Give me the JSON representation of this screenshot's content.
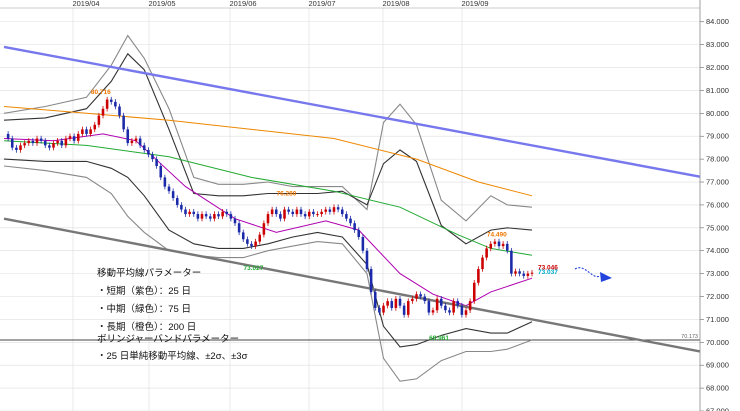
{
  "chart_data": {
    "type": "candlestick",
    "x_months": [
      "2019/04",
      "2019/05",
      "2019/06",
      "2019/07",
      "2019/08",
      "2019/09"
    ],
    "y_ticks": [
      "84.000",
      "83.000",
      "82.000",
      "81.000",
      "80.000",
      "79.000",
      "78.000",
      "77.000",
      "76.000",
      "75.000",
      "74.000",
      "73.000",
      "72.000",
      "71.000",
      "70.000",
      "69.000",
      "68.000",
      "67.000"
    ],
    "ylim": [
      67,
      84.6
    ],
    "grid": true,
    "closes": [
      79.1,
      78.9,
      78.5,
      78.4,
      78.6,
      78.7,
      78.8,
      78.7,
      78.9,
      78.8,
      78.6,
      78.5,
      78.7,
      78.8,
      78.6,
      78.9,
      79.0,
      78.8,
      79.1,
      79.3,
      79.1,
      79.3,
      79.5,
      79.9,
      80.2,
      80.6,
      80.5,
      80.3,
      79.9,
      79.3,
      78.7,
      78.8,
      78.9,
      78.6,
      78.4,
      78.2,
      78.0,
      77.7,
      77.2,
      76.8,
      76.6,
      76.3,
      76.0,
      75.8,
      75.6,
      75.7,
      75.6,
      75.4,
      75.6,
      75.5,
      75.4,
      75.6,
      75.5,
      75.7,
      75.6,
      75.4,
      75.2,
      74.8,
      74.5,
      74.3,
      74.2,
      74.4,
      74.7,
      75.2,
      75.6,
      75.8,
      75.6,
      75.4,
      75.8,
      75.7,
      75.6,
      75.8,
      75.6,
      75.5,
      75.7,
      75.6,
      75.6,
      75.7,
      75.8,
      75.7,
      75.9,
      75.8,
      75.6,
      75.4,
      75.2,
      74.9,
      74.6,
      74.0,
      73.2,
      72.2,
      71.5,
      71.3,
      71.6,
      71.8,
      71.5,
      71.9,
      71.6,
      71.2,
      71.8,
      71.9,
      72.1,
      72.0,
      71.8,
      71.3,
      71.4,
      71.9,
      71.6,
      71.4,
      71.3,
      71.8,
      71.6,
      71.2,
      71.4,
      71.8,
      72.6,
      73.2,
      73.7,
      74.1,
      74.3,
      74.4,
      74.2,
      74.3,
      74.0,
      73.0,
      73.1,
      73.0,
      72.9,
      73.0,
      73.04
    ],
    "moving_averages": [
      {
        "name": "short-25",
        "color": "#b000b0",
        "points": [
          [
            0,
            78.9
          ],
          [
            12,
            78.8
          ],
          [
            24,
            79.1
          ],
          [
            32,
            78.8
          ],
          [
            44,
            76.8
          ],
          [
            56,
            75.4
          ],
          [
            66,
            74.8
          ],
          [
            78,
            75.3
          ],
          [
            86,
            74.9
          ],
          [
            96,
            73.0
          ],
          [
            104,
            72.1
          ],
          [
            112,
            71.6
          ],
          [
            118,
            72.2
          ],
          [
            128,
            72.8
          ]
        ]
      },
      {
        "name": "medium-75",
        "color": "#22aa33",
        "points": [
          [
            0,
            78.8
          ],
          [
            20,
            78.6
          ],
          [
            40,
            78.1
          ],
          [
            60,
            77.2
          ],
          [
            80,
            76.6
          ],
          [
            96,
            75.9
          ],
          [
            110,
            74.7
          ],
          [
            118,
            74.1
          ],
          [
            128,
            73.8
          ]
        ]
      },
      {
        "name": "long-200",
        "color": "#ee8800",
        "points": [
          [
            0,
            80.3
          ],
          [
            20,
            80.0
          ],
          [
            40,
            79.7
          ],
          [
            60,
            79.3
          ],
          [
            80,
            78.9
          ],
          [
            100,
            78.0
          ],
          [
            115,
            77.0
          ],
          [
            128,
            76.4
          ]
        ]
      }
    ],
    "bollinger": [
      {
        "name": "+3σ",
        "color": "#888888",
        "points": [
          [
            0,
            80.0
          ],
          [
            10,
            80.3
          ],
          [
            20,
            80.7
          ],
          [
            26,
            82.1
          ],
          [
            30,
            83.4
          ],
          [
            34,
            82.4
          ],
          [
            40,
            80.2
          ],
          [
            46,
            77.2
          ],
          [
            52,
            76.9
          ],
          [
            58,
            76.9
          ],
          [
            64,
            77.0
          ],
          [
            70,
            76.8
          ],
          [
            76,
            76.8
          ],
          [
            82,
            76.8
          ],
          [
            88,
            75.8
          ],
          [
            92,
            79.6
          ],
          [
            96,
            80.4
          ],
          [
            100,
            79.5
          ],
          [
            106,
            76.2
          ],
          [
            112,
            75.3
          ],
          [
            118,
            76.4
          ],
          [
            122,
            76.0
          ],
          [
            128,
            75.9
          ]
        ]
      },
      {
        "name": "+2σ",
        "color": "#333333",
        "points": [
          [
            0,
            79.7
          ],
          [
            10,
            79.8
          ],
          [
            20,
            80.2
          ],
          [
            26,
            81.4
          ],
          [
            30,
            82.6
          ],
          [
            34,
            81.9
          ],
          [
            40,
            79.3
          ],
          [
            46,
            76.5
          ],
          [
            52,
            76.4
          ],
          [
            58,
            76.4
          ],
          [
            64,
            76.5
          ],
          [
            70,
            76.5
          ],
          [
            76,
            76.5
          ],
          [
            82,
            76.6
          ],
          [
            88,
            76.0
          ],
          [
            92,
            77.8
          ],
          [
            96,
            78.4
          ],
          [
            100,
            77.9
          ],
          [
            106,
            75.1
          ],
          [
            112,
            74.3
          ],
          [
            118,
            74.9
          ],
          [
            122,
            75.0
          ],
          [
            128,
            74.9
          ]
        ]
      },
      {
        "name": "-2σ",
        "color": "#333333",
        "points": [
          [
            0,
            78.0
          ],
          [
            10,
            77.9
          ],
          [
            20,
            77.9
          ],
          [
            26,
            77.6
          ],
          [
            30,
            77.2
          ],
          [
            34,
            76.4
          ],
          [
            40,
            74.9
          ],
          [
            46,
            74.3
          ],
          [
            52,
            74.1
          ],
          [
            58,
            74.1
          ],
          [
            64,
            74.3
          ],
          [
            70,
            74.6
          ],
          [
            76,
            74.8
          ],
          [
            82,
            74.6
          ],
          [
            88,
            73.4
          ],
          [
            92,
            70.7
          ],
          [
            96,
            69.8
          ],
          [
            100,
            69.9
          ],
          [
            106,
            70.3
          ],
          [
            112,
            70.6
          ],
          [
            118,
            70.4
          ],
          [
            122,
            70.4
          ],
          [
            128,
            70.9
          ]
        ]
      },
      {
        "name": "-3σ",
        "color": "#888888",
        "points": [
          [
            0,
            77.7
          ],
          [
            10,
            77.5
          ],
          [
            20,
            77.2
          ],
          [
            26,
            76.5
          ],
          [
            30,
            75.5
          ],
          [
            34,
            74.8
          ],
          [
            40,
            74.0
          ],
          [
            46,
            73.8
          ],
          [
            52,
            73.7
          ],
          [
            58,
            73.7
          ],
          [
            64,
            74.0
          ],
          [
            70,
            74.2
          ],
          [
            76,
            74.4
          ],
          [
            82,
            74.3
          ],
          [
            88,
            73.0
          ],
          [
            92,
            69.3
          ],
          [
            96,
            68.3
          ],
          [
            100,
            68.4
          ],
          [
            106,
            69.2
          ],
          [
            112,
            69.6
          ],
          [
            118,
            69.6
          ],
          [
            122,
            69.7
          ],
          [
            128,
            70.1
          ]
        ]
      }
    ],
    "trendlines": [
      {
        "name": "upper-channel",
        "color": "#7777ee",
        "from": [
          0,
          82.9
        ],
        "to": [
          128,
          78.6
        ]
      },
      {
        "name": "lower-channel",
        "color": "#777777",
        "from": [
          0,
          75.4
        ],
        "to": [
          128,
          71.0
        ]
      }
    ],
    "horizontal_line": {
      "value": 70.1,
      "label": "70.173"
    },
    "annotations": [
      {
        "text": "80.716",
        "x": 23,
        "y": 80.72,
        "color": "#ee7700"
      },
      {
        "text": "76.280",
        "x": 68,
        "y": 76.28,
        "color": "#ee7700"
      },
      {
        "text": "73.027",
        "x": 60,
        "y": 73.03,
        "color": "#22aa33"
      },
      {
        "text": "74.490",
        "x": 119,
        "y": 74.49,
        "color": "#ee7700"
      },
      {
        "text": "69.961",
        "x": 105,
        "y": 69.96,
        "color": "#22aa33"
      },
      {
        "text": "73.046",
        "x": 128,
        "y": 73.05,
        "color": "#cc0000"
      },
      {
        "text": "73.037",
        "x": 128,
        "y": 72.85,
        "color": "#00aacc"
      }
    ],
    "notes": [
      "移動平均線パラメーター",
      "・短期（紫色）：25 日",
      "・中期（緑色）：75 日",
      "・長期（橙色）：200 日",
      "ボリンジャーバンドパラメーター",
      "・25 日単純移動平均線、±2σ、±3σ"
    ],
    "colors": {
      "up_candle": "#cc0000",
      "down_candle": "#1a2aa8",
      "forecast_arrow": "#2244dd"
    }
  }
}
